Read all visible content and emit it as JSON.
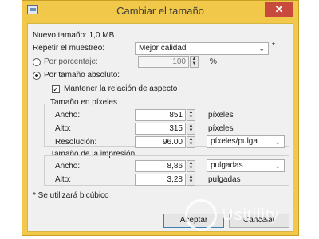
{
  "window": {
    "title": "Cambiar el tamaño",
    "close": "✕"
  },
  "info": {
    "new_size": "Nuevo tamaño: 1,0 MB"
  },
  "resample": {
    "label": "Repetir el muestreo:",
    "value": "Mejor calidad",
    "suffix": "*"
  },
  "percent": {
    "label": "Por porcentaje:",
    "value": "100",
    "unit": "%"
  },
  "absolute": {
    "label": "Por tamaño absoluto:",
    "keep_ratio": "Mantener la relación de aspecto"
  },
  "pixel_size": {
    "heading": "Tamaño en píxeles",
    "width_label": "Ancho:",
    "width_value": "851",
    "width_unit": "píxeles",
    "height_label": "Alto:",
    "height_value": "315",
    "height_unit": "píxeles",
    "res_label": "Resolución:",
    "res_value": "96.00",
    "res_unit": "píxeles/pulga"
  },
  "print_size": {
    "heading": "Tamaño de la impresión",
    "width_label": "Ancho:",
    "width_value": "8,86",
    "width_unit": "pulgadas",
    "height_label": "Alto:",
    "height_value": "3,28",
    "height_unit": "pulgadas"
  },
  "footnote": "* Se utilizará bicúbico",
  "buttons": {
    "ok": "Aceptar",
    "cancel": "Cancelar"
  },
  "watermark": {
    "text": "Usitility"
  },
  "colors": {
    "window_frame": "#f2c84b",
    "close": "#c74a3d",
    "client": "#f0f0f0"
  }
}
